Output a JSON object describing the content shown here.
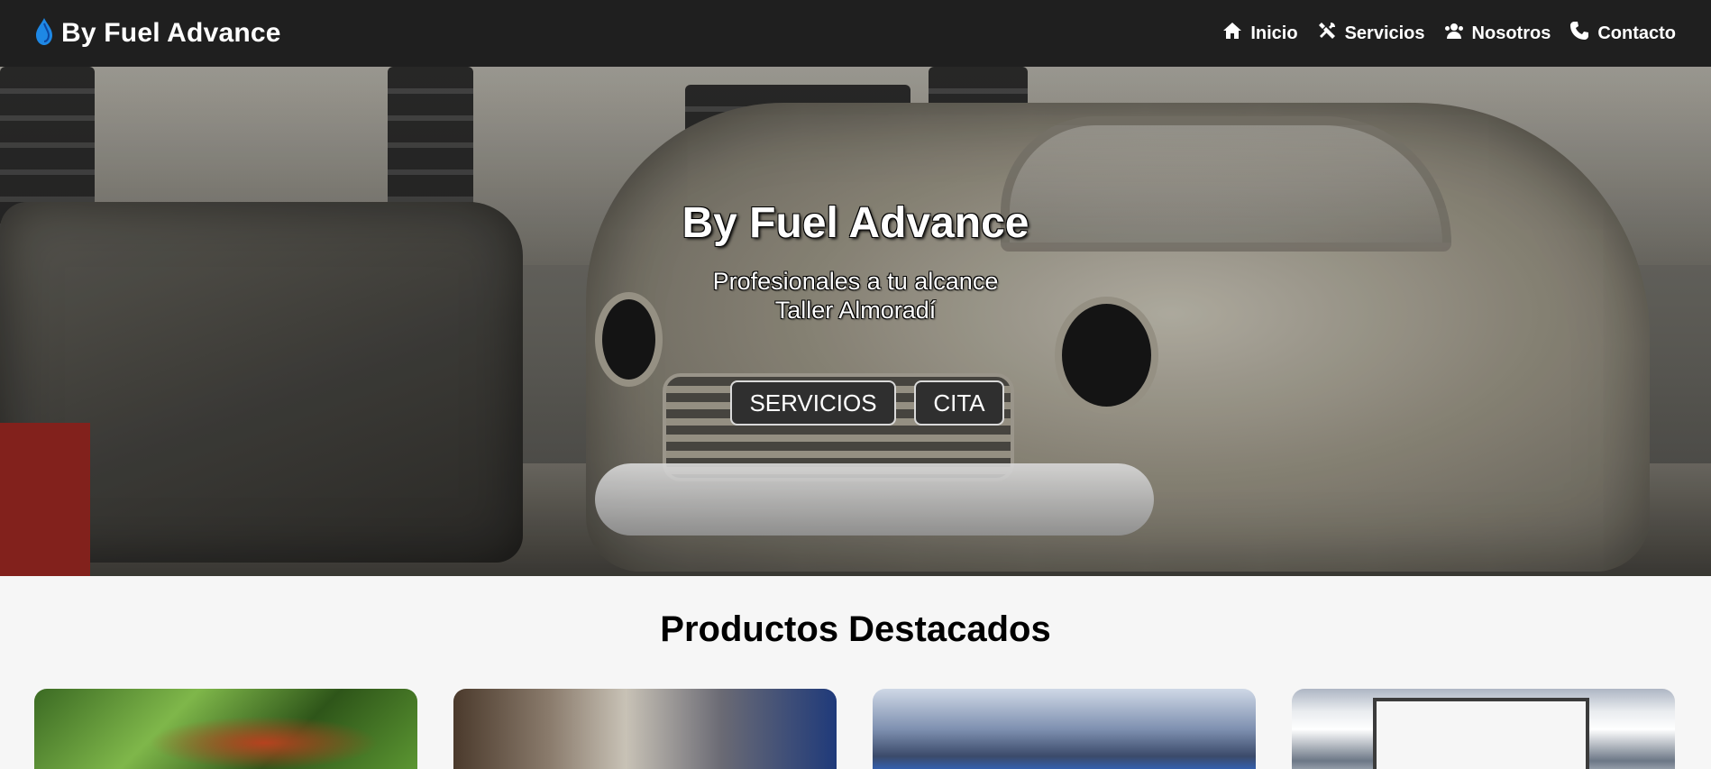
{
  "brand": {
    "title": "By Fuel Advance",
    "icon": "fuel-drop-icon",
    "icon_color": "#1e88e5"
  },
  "nav": [
    {
      "label": "Inicio",
      "icon": "home-icon"
    },
    {
      "label": "Servicios",
      "icon": "tools-icon"
    },
    {
      "label": "Nosotros",
      "icon": "users-icon"
    },
    {
      "label": "Contacto",
      "icon": "phone-icon"
    }
  ],
  "hero": {
    "title": "By Fuel Advance",
    "subtitle_line1": "Profesionales a tu alcance",
    "subtitle_line2": "Taller Almoradí",
    "buttons": {
      "servicios": "SERVICIOS",
      "cita": "CITA"
    }
  },
  "products": {
    "title": "Productos Destacados"
  },
  "colors": {
    "navbar_bg": "#1f1f1f",
    "button_bg": "#2f2f2f",
    "page_bg": "#f6f6f6"
  }
}
